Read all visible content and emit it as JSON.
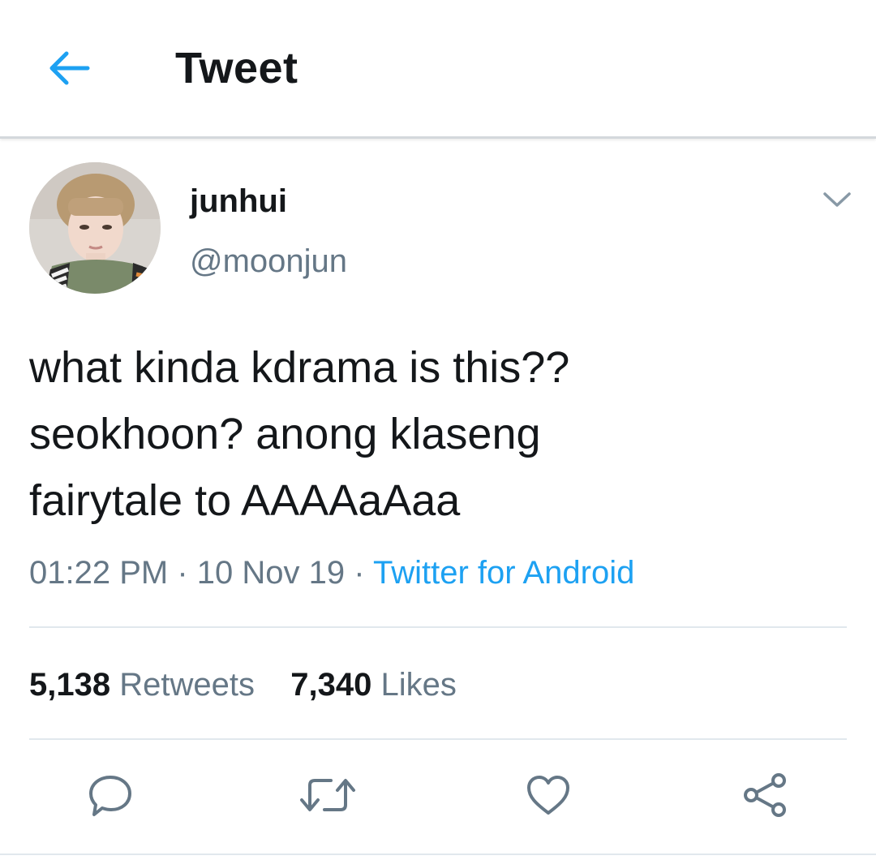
{
  "header": {
    "title": "Tweet",
    "back_icon": "arrow-left-icon",
    "accent": "#1da1f2"
  },
  "author": {
    "display_name": "junhui",
    "handle": "@moonjun",
    "caret_icon": "chevron-down-icon"
  },
  "tweet": {
    "lines": [
      "what kinda kdrama is this??",
      "seokhoon? anong klaseng",
      "fairytale to AAAAaAaa"
    ],
    "time": "01:22 PM",
    "date": "10 Nov 19",
    "separator": "·",
    "source": "Twitter for Android"
  },
  "stats": {
    "retweets_count": "5,138",
    "retweets_label": "Retweets",
    "likes_count": "7,340",
    "likes_label": "Likes"
  },
  "actions": {
    "reply_icon": "reply-icon",
    "retweet_icon": "retweet-icon",
    "like_icon": "heart-icon",
    "share_icon": "share-icon"
  },
  "colors": {
    "text": "#14171a",
    "secondary": "#657786",
    "link": "#1da1f2",
    "divider": "#e1e8ed"
  }
}
